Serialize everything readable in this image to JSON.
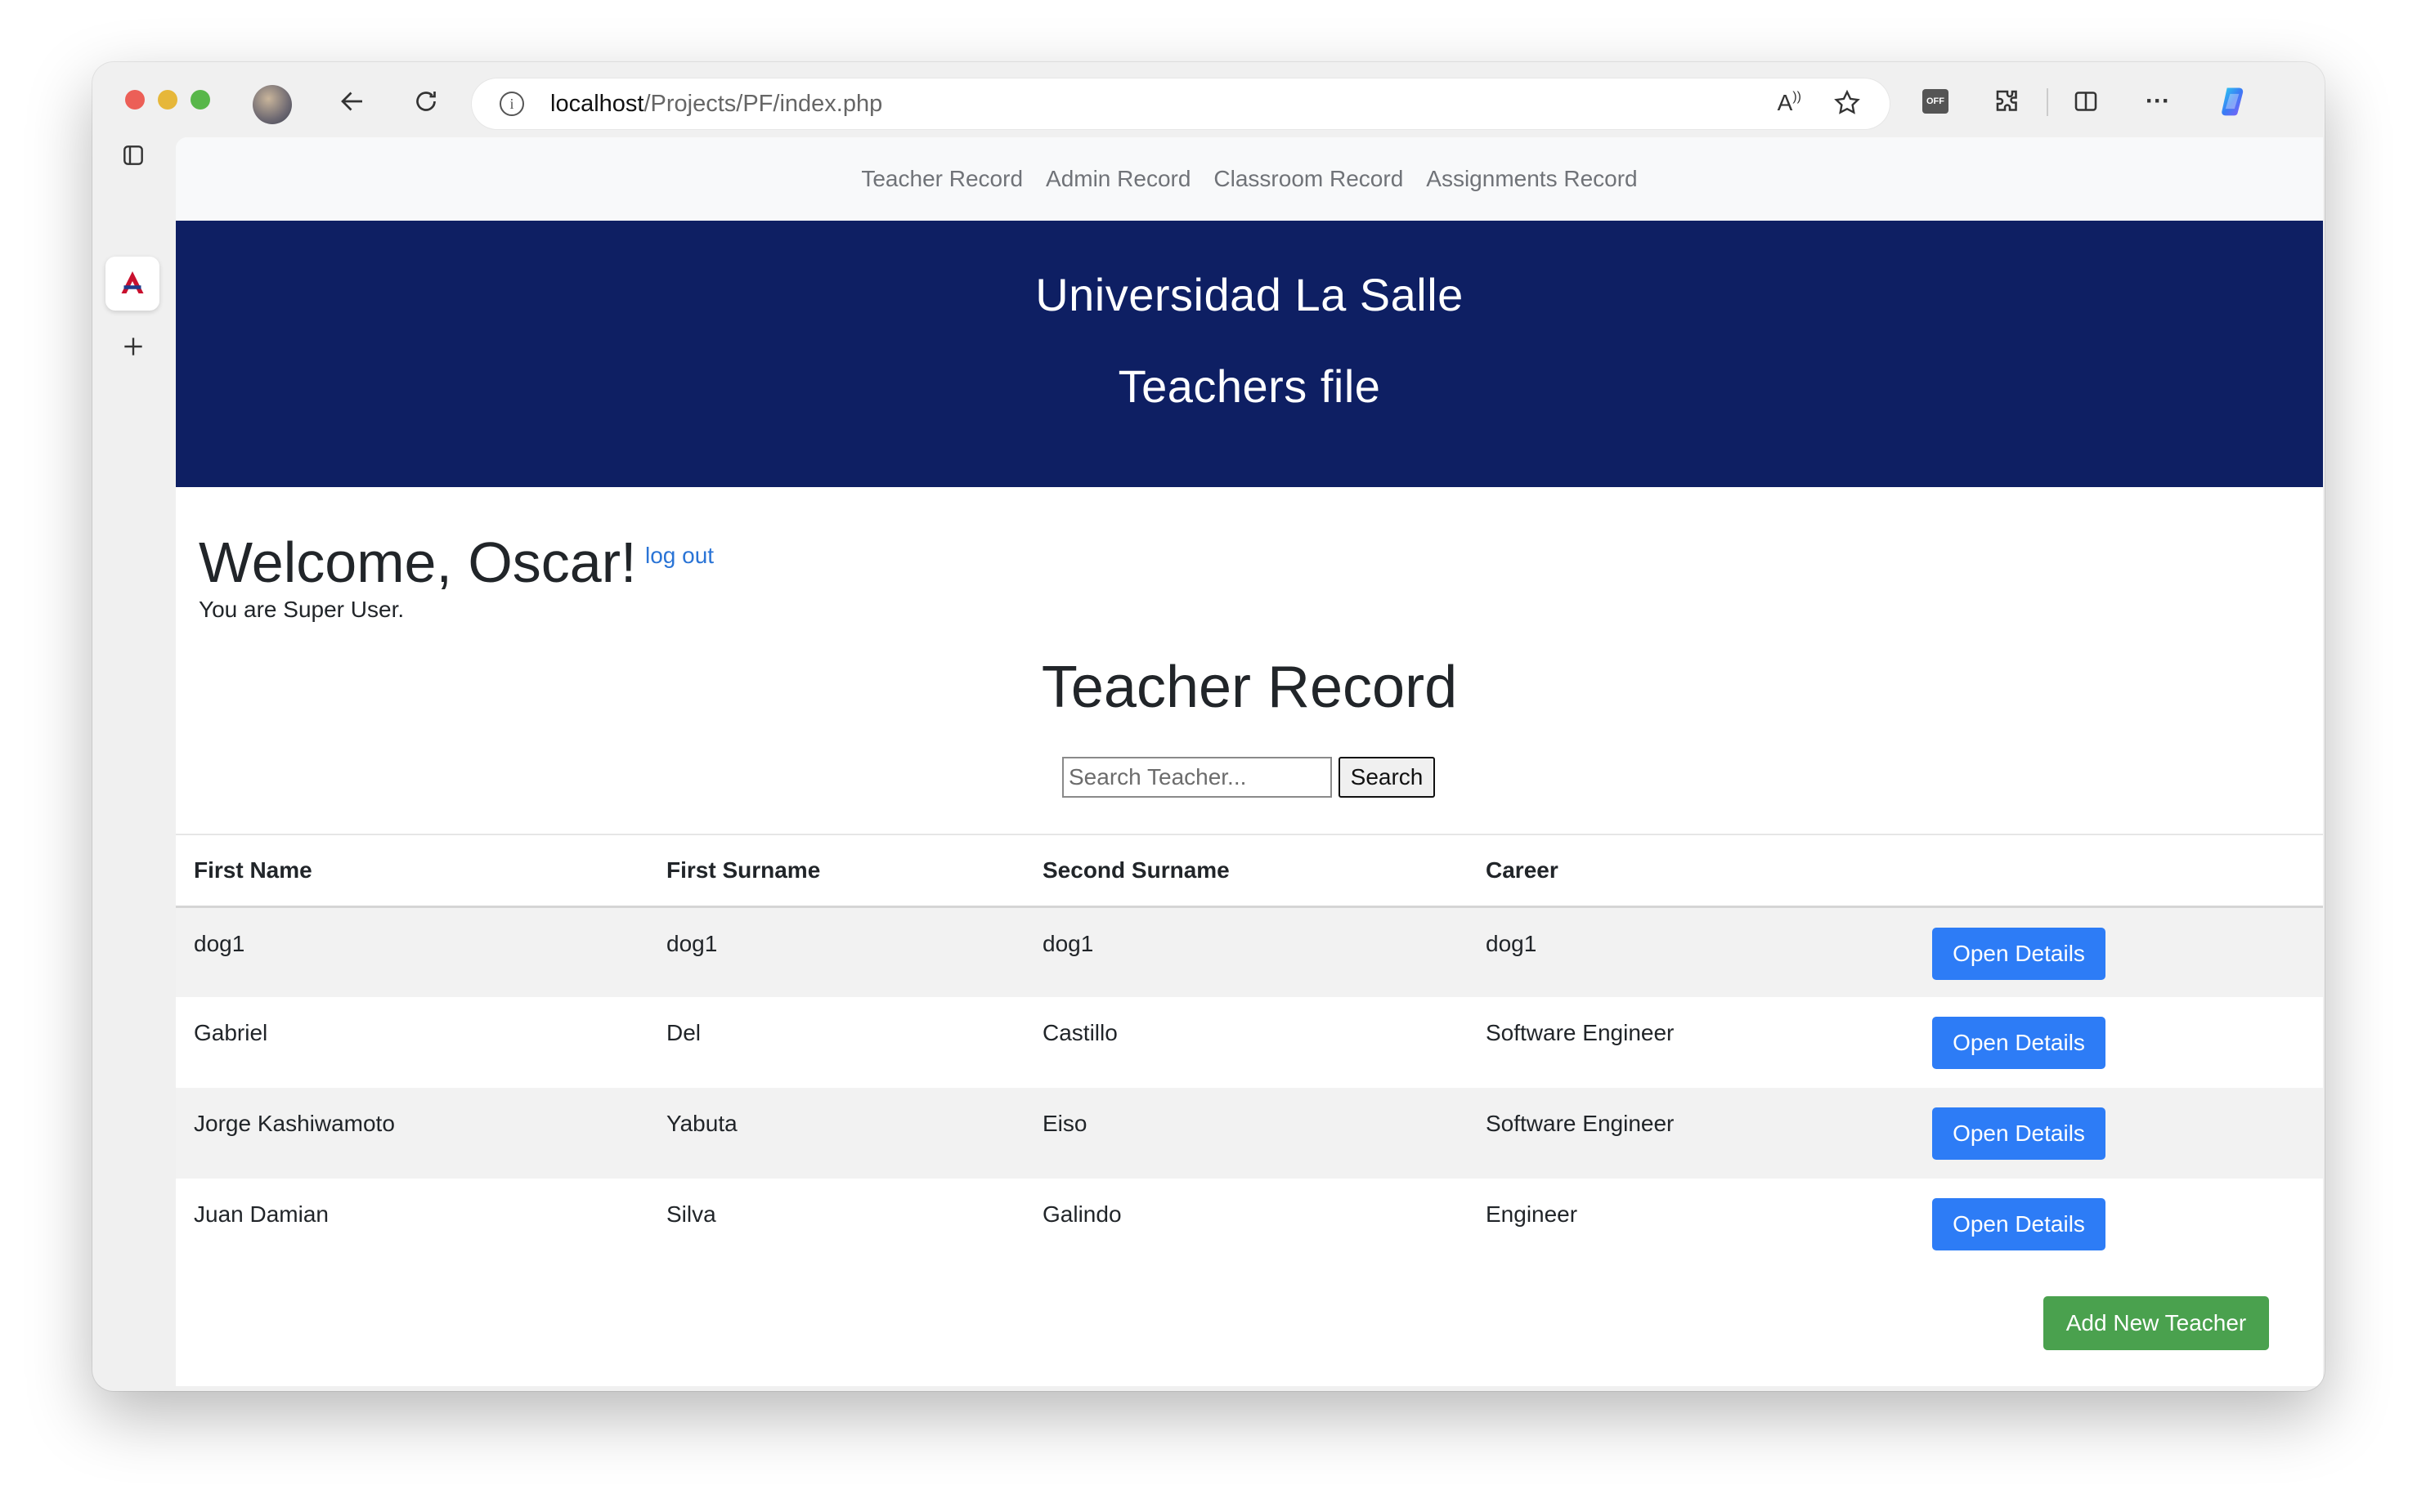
{
  "browser": {
    "url_host": "localhost",
    "url_path": "/Projects/PF/index.php",
    "read_aloud_label": "A",
    "ext_off_label": "OFF",
    "more_label": "···"
  },
  "nav": {
    "items": [
      {
        "label": "Teacher Record"
      },
      {
        "label": "Admin Record"
      },
      {
        "label": "Classroom Record"
      },
      {
        "label": "Assignments Record"
      }
    ]
  },
  "banner": {
    "title": "Universidad La Salle",
    "subtitle": "Teachers file"
  },
  "user": {
    "welcome": "Welcome, Oscar!",
    "logout": "log out",
    "role_text": "You are Super User."
  },
  "main": {
    "title": "Teacher Record",
    "search_placeholder": "Search Teacher...",
    "search_button": "Search"
  },
  "table": {
    "headers": [
      "First Name",
      "First Surname",
      "Second Surname",
      "Career",
      ""
    ],
    "rows": [
      {
        "first_name": "dog1",
        "first_surname": "dog1",
        "second_surname": "dog1",
        "career": "dog1",
        "action": "Open Details"
      },
      {
        "first_name": "Gabriel",
        "first_surname": "Del",
        "second_surname": "Castillo",
        "career": "Software Engineer",
        "action": "Open Details"
      },
      {
        "first_name": "Jorge Kashiwamoto",
        "first_surname": "Yabuta",
        "second_surname": "Eiso",
        "career": "Software Engineer",
        "action": "Open Details"
      },
      {
        "first_name": "Juan Damian",
        "first_surname": "Silva",
        "second_surname": "Galindo",
        "career": "Engineer",
        "action": "Open Details"
      }
    ]
  },
  "actions": {
    "add_teacher": "Add New Teacher"
  },
  "colors": {
    "banner": "#0e1f63",
    "primary_button": "#2d7cf6",
    "success_button": "#4aa14e",
    "link": "#2a74d6"
  }
}
